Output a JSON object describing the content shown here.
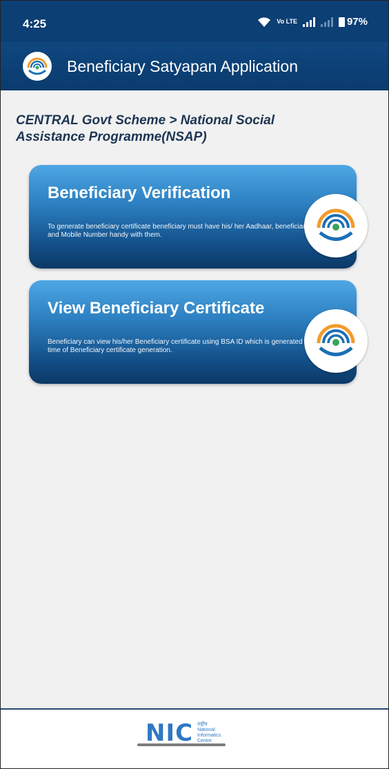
{
  "status_bar": {
    "time": "4:25",
    "network_label": "Vo LTE",
    "battery": "97%"
  },
  "app_bar": {
    "title": "Beneficiary Satyapan Application",
    "logo_icon": "satyapan-logo-icon"
  },
  "breadcrumb": {
    "line1": "CENTRAL Govt Scheme > National Social",
    "line2": "Assistance Programme(NSAP)"
  },
  "cards": [
    {
      "title": "Beneficiary Verification",
      "description": "To generate beneficiary certificate beneficiary must have his/ her Aadhaar, beneficiary id and Mobile Number handy with them.",
      "icon": "satyapan-logo-icon"
    },
    {
      "title": "View Beneficiary Certificate",
      "description": "Beneficiary can view his/her Beneficiary certificate using BSA ID which is generated at time of Beneficiary certificate generation.",
      "icon": "satyapan-logo-icon"
    }
  ],
  "footer": {
    "logo_letters": "NIC",
    "logo_hindi": "राष्ट्रीय",
    "logo_line1": "National",
    "logo_line2": "Informatics",
    "logo_line3": "Centre"
  },
  "colors": {
    "app_bar": "#0b3b6e",
    "card_top": "#4ea7e4",
    "card_bottom": "#0b3966",
    "logo_orange": "#f39a2c",
    "logo_blue": "#1c6fb5"
  }
}
